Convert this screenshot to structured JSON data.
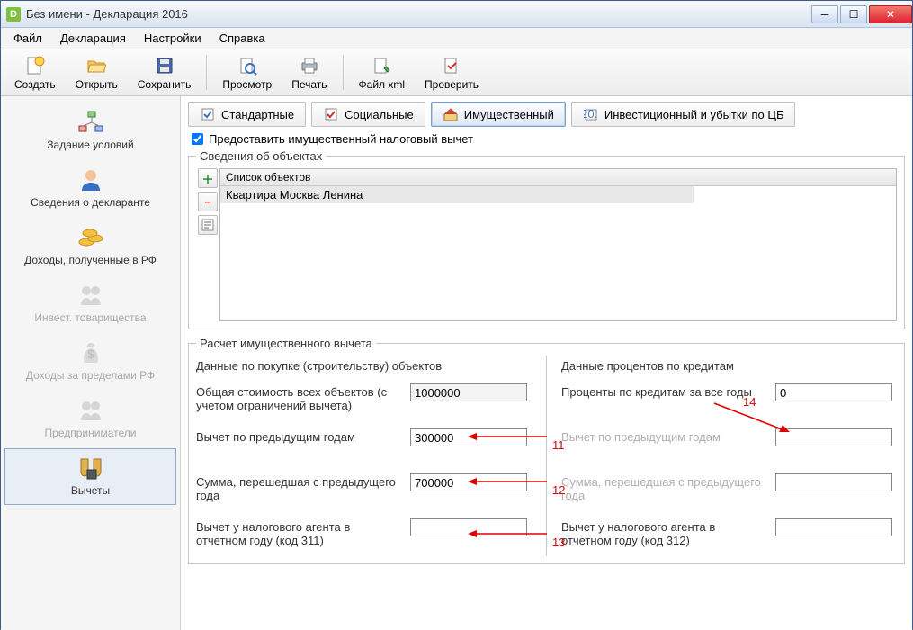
{
  "title": "Без имени - Декларация 2016",
  "menu": {
    "file": "Файл",
    "decl": "Декларация",
    "settings": "Настройки",
    "help": "Справка"
  },
  "toolbar": {
    "create": "Создать",
    "open": "Открыть",
    "save": "Сохранить",
    "preview": "Просмотр",
    "print": "Печать",
    "xml": "Файл xml",
    "check": "Проверить"
  },
  "sidebar": {
    "conditions": "Задание условий",
    "declarant": "Сведения о декларанте",
    "income_rf": "Доходы, полученные в РФ",
    "invest": "Инвест. товарищества",
    "income_abroad": "Доходы за пределами РФ",
    "entrepreneurs": "Предприниматели",
    "deductions": "Вычеты"
  },
  "tabs": {
    "standard": "Стандартные",
    "social": "Социальные",
    "property": "Имущественный",
    "investment": "Инвестиционный и убытки по ЦБ"
  },
  "checkbox_label": "Предоставить имущественный налоговый вычет",
  "objects": {
    "legend": "Сведения об объектах",
    "header": "Список объектов",
    "row1": "Квартира Москва  Ленина"
  },
  "calc": {
    "legend": "Расчет имущественного вычета",
    "left": {
      "head": "Данные по покупке (строительству) объектов",
      "total_label": "Общая стоимость всех объектов (с учетом ограничений вычета)",
      "total_value": "1000000",
      "prev_years_label": "Вычет по предыдущим годам",
      "prev_years_value": "300000",
      "carried_label": "Сумма, перешедшая с предыдущего года",
      "carried_value": "700000",
      "agent_label": "Вычет у налогового агента в отчетном году (код 311)",
      "agent_value": ""
    },
    "right": {
      "head": "Данные процентов по кредитам",
      "interest_label": "Проценты по кредитам за все годы",
      "interest_value": "0",
      "prev_years_label": "Вычет по предыдущим годам",
      "prev_years_value": "",
      "carried_label": "Сумма, перешедшая с предыдущего года",
      "carried_value": "",
      "agent_label": "Вычет у налогового агента в отчетном году (код 312)",
      "agent_value": ""
    }
  },
  "annotations": {
    "a11": "11",
    "a12": "12",
    "a13": "13",
    "a14": "14"
  }
}
